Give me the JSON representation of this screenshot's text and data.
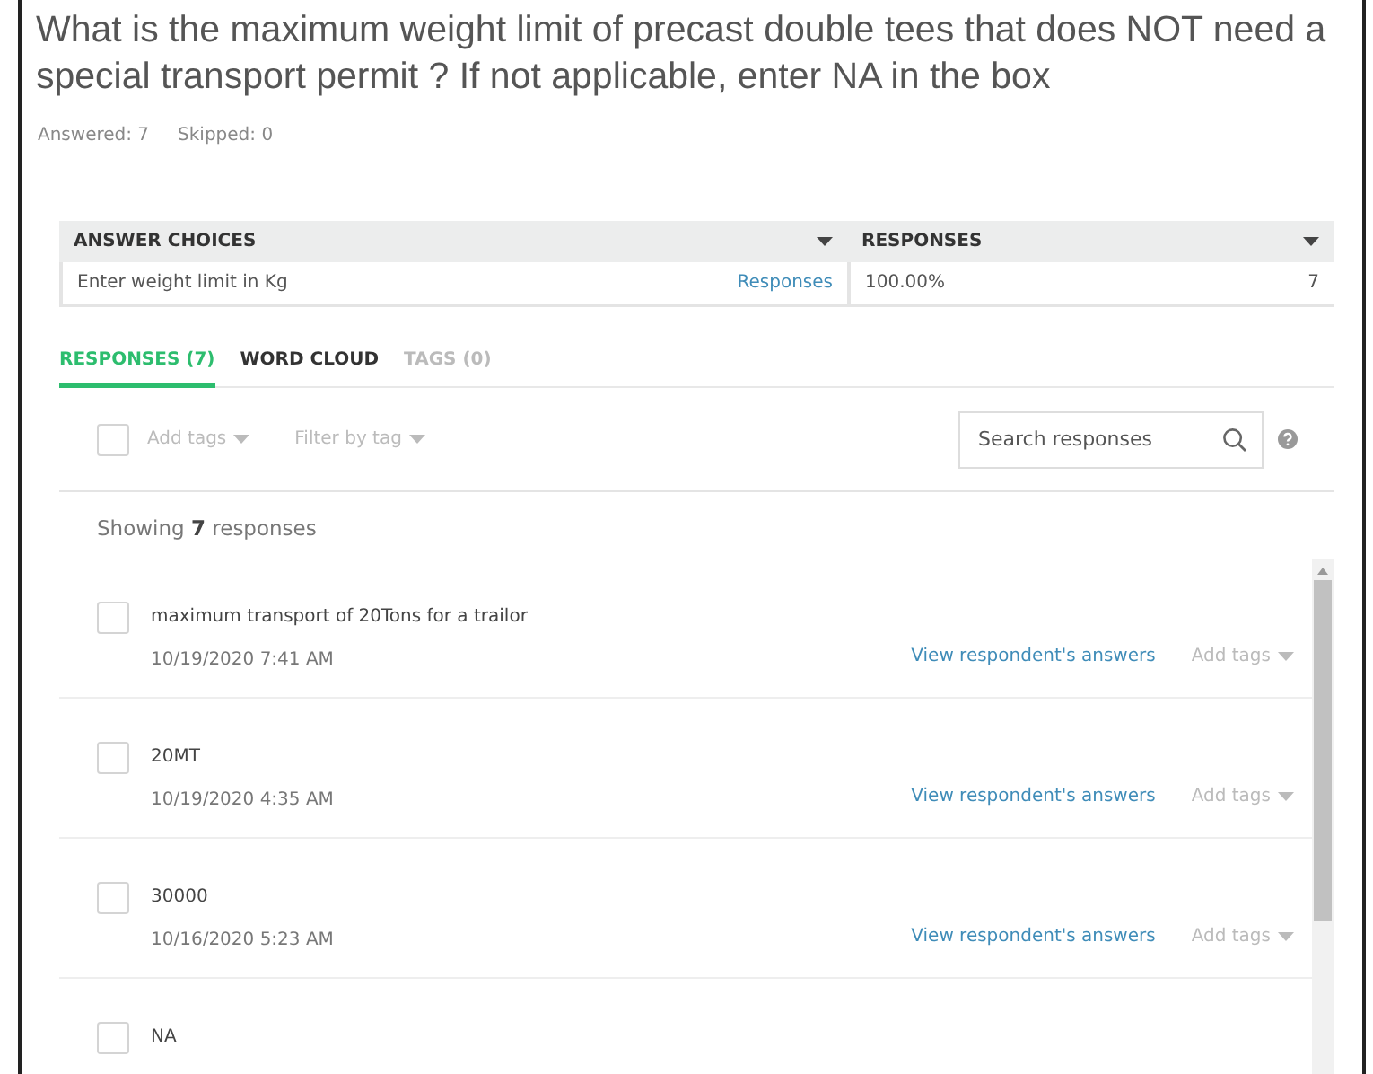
{
  "question": {
    "title": "What is the maximum weight limit of precast double tees that does NOT need a special transport permit ? If not applicable, enter NA in the box",
    "answered": "Answered: 7",
    "skipped": "Skipped: 0"
  },
  "table": {
    "columns": [
      "ANSWER CHOICES",
      "RESPONSES"
    ],
    "rows": [
      {
        "choice": "Enter weight limit in Kg",
        "link": "Responses",
        "percent": "100.00%",
        "count": "7"
      }
    ]
  },
  "tabs": [
    {
      "label": "RESPONSES (7)",
      "selected": true
    },
    {
      "label": "WORD CLOUD",
      "selected": false
    },
    {
      "label": "TAGS (0)",
      "selected": false
    }
  ],
  "toolbar": {
    "select_all_checked": false,
    "add_tags": "Add tags",
    "filter": "Filter by tag",
    "search": {
      "placeholder": "Search responses"
    }
  },
  "showing": "Showing **7** responses",
  "responses": [
    {
      "text": "maximum transport of 20Tons for a trailor",
      "date": "10/19/2020 7:41 AM",
      "link": "View respondent's answers",
      "tags": "Add tags",
      "checked": false
    },
    {
      "text": "20MT",
      "date": "10/19/2020 4:35 AM",
      "link": "View respondent's answers",
      "tags": "Add tags",
      "checked": false
    },
    {
      "text": "30000",
      "date": "10/16/2020 5:23 AM",
      "link": "View respondent's answers",
      "tags": "Add tags",
      "checked": false
    },
    {
      "text": "NA",
      "checked": false
    }
  ]
}
